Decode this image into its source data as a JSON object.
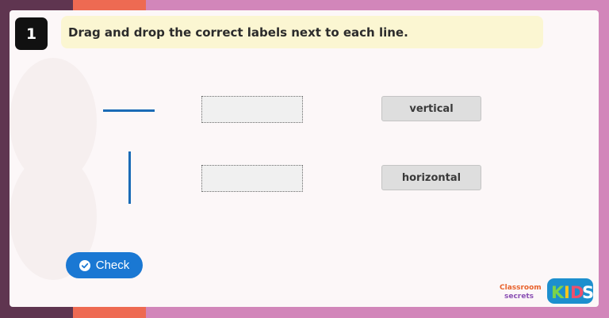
{
  "question": {
    "number": "1",
    "instruction": "Drag and drop the correct labels next to each line."
  },
  "labels": [
    {
      "text": "vertical"
    },
    {
      "text": "horizontal"
    }
  ],
  "check_button": {
    "label": "Check",
    "icon": "check-circle-icon"
  },
  "brand": {
    "name": "Classroom secrets",
    "kids": "KIDS"
  },
  "colors": {
    "line": "#1a6bb6",
    "accent": "#1a78d3",
    "instruction_bg": "#fbf6d2"
  }
}
